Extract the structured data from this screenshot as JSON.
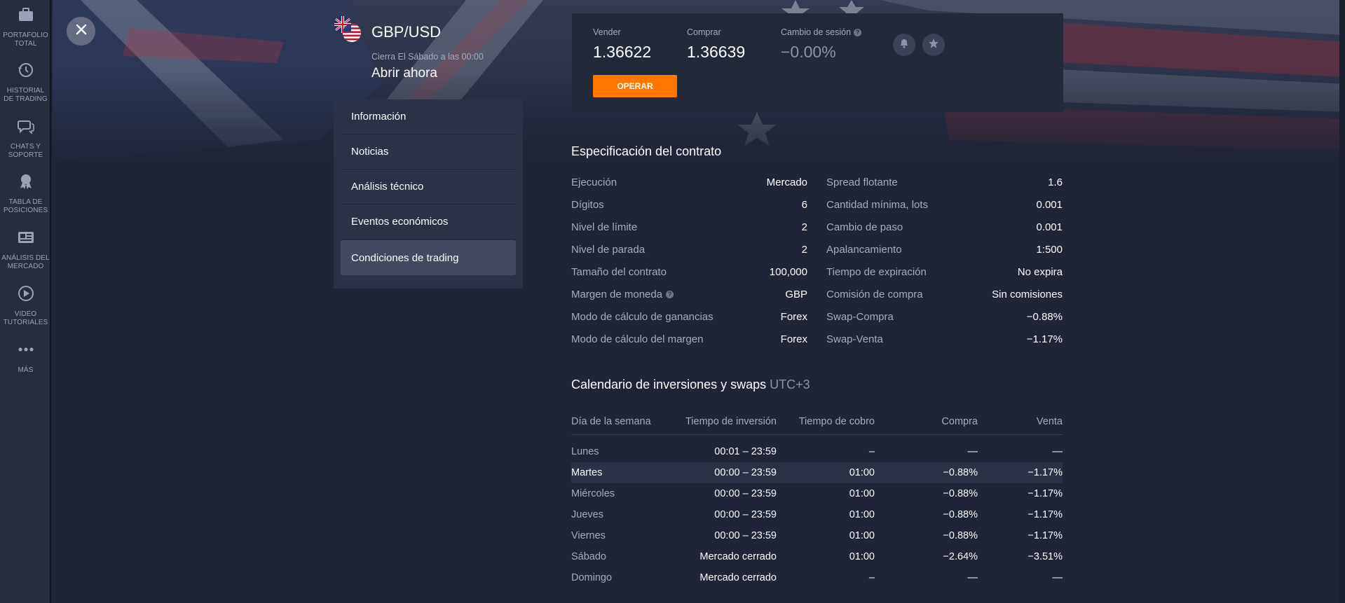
{
  "sidebar": {
    "items": [
      {
        "label": "PORTAFOLIO TOTAL",
        "icon": "briefcase-icon"
      },
      {
        "label": "HISTORIAL DE TRADING",
        "icon": "history-icon"
      },
      {
        "label": "CHATS Y SOPORTE",
        "icon": "chat-icon"
      },
      {
        "label": "TABLA DE POSICIONES",
        "icon": "award-icon"
      },
      {
        "label": "ANÁLISIS DEL MERCADO",
        "icon": "newspaper-icon"
      },
      {
        "label": "VIDEO TUTORIALES",
        "icon": "play-icon"
      },
      {
        "label": "MÁS",
        "icon": "more-icon"
      }
    ]
  },
  "instrument": {
    "pair": "GBP/USD",
    "close_note": "Cierra El Sábado a las 00:00",
    "open_now": "Abrir ahora"
  },
  "menu": {
    "items": [
      "Información",
      "Noticias",
      "Análisis técnico",
      "Eventos económicos",
      "Condiciones de trading"
    ],
    "active_index": 4
  },
  "quote": {
    "sell_label": "Vender",
    "sell_value": "1.36622",
    "buy_label": "Comprar",
    "buy_value": "1.36639",
    "change_label": "Cambio de sesión",
    "change_value": "−0.00%",
    "trade_button": "OPERAR"
  },
  "spec": {
    "title": "Especificación del contrato",
    "left": [
      {
        "k": "Ejecución",
        "v": "Mercado"
      },
      {
        "k": "Dígitos",
        "v": "6"
      },
      {
        "k": "Nivel de límite",
        "v": "2"
      },
      {
        "k": "Nivel de parada",
        "v": "2"
      },
      {
        "k": "Tamaño del contrato",
        "v": "100,000"
      },
      {
        "k": "Margen de moneda",
        "v": "GBP",
        "help": true
      },
      {
        "k": "Modo de cálculo de ganancias",
        "v": "Forex"
      },
      {
        "k": "Modo de cálculo del margen",
        "v": "Forex"
      }
    ],
    "right": [
      {
        "k": "Spread flotante",
        "v": "1.6"
      },
      {
        "k": "Cantidad mínima, lots",
        "v": "0.001"
      },
      {
        "k": "Cambio de paso",
        "v": "0.001"
      },
      {
        "k": "Apalancamiento",
        "v": "1:500"
      },
      {
        "k": "Tiempo de expiración",
        "v": "No expira"
      },
      {
        "k": "Comisión de compra",
        "v": "Sin comisiones"
      },
      {
        "k": "Swap-Compra",
        "v": "−0.88%"
      },
      {
        "k": "Swap-Venta",
        "v": "−1.17%"
      }
    ]
  },
  "calendar": {
    "title": "Calendario de inversiones y swaps",
    "timezone": "UTC+3",
    "headers": [
      "Día de la semana",
      "Tiempo de inversión",
      "Tiempo de cobro",
      "Compra",
      "Venta"
    ],
    "rows": [
      [
        "Lunes",
        "00:01 – 23:59",
        "–",
        "—",
        "—"
      ],
      [
        "Martes",
        "00:00 – 23:59",
        "01:00",
        "−0.88%",
        "−1.17%"
      ],
      [
        "Miércoles",
        "00:00 – 23:59",
        "01:00",
        "−0.88%",
        "−1.17%"
      ],
      [
        "Jueves",
        "00:00 – 23:59",
        "01:00",
        "−0.88%",
        "−1.17%"
      ],
      [
        "Viernes",
        "00:00 – 23:59",
        "01:00",
        "−0.88%",
        "−1.17%"
      ],
      [
        "Sábado",
        "Mercado cerrado",
        "01:00",
        "−2.64%",
        "−3.51%"
      ],
      [
        "Domingo",
        "Mercado cerrado",
        "–",
        "—",
        "—"
      ]
    ],
    "highlight_index": 1
  },
  "colors": {
    "accent": "#ff7700",
    "background": "#1f2536",
    "panel": "#2b3245"
  }
}
